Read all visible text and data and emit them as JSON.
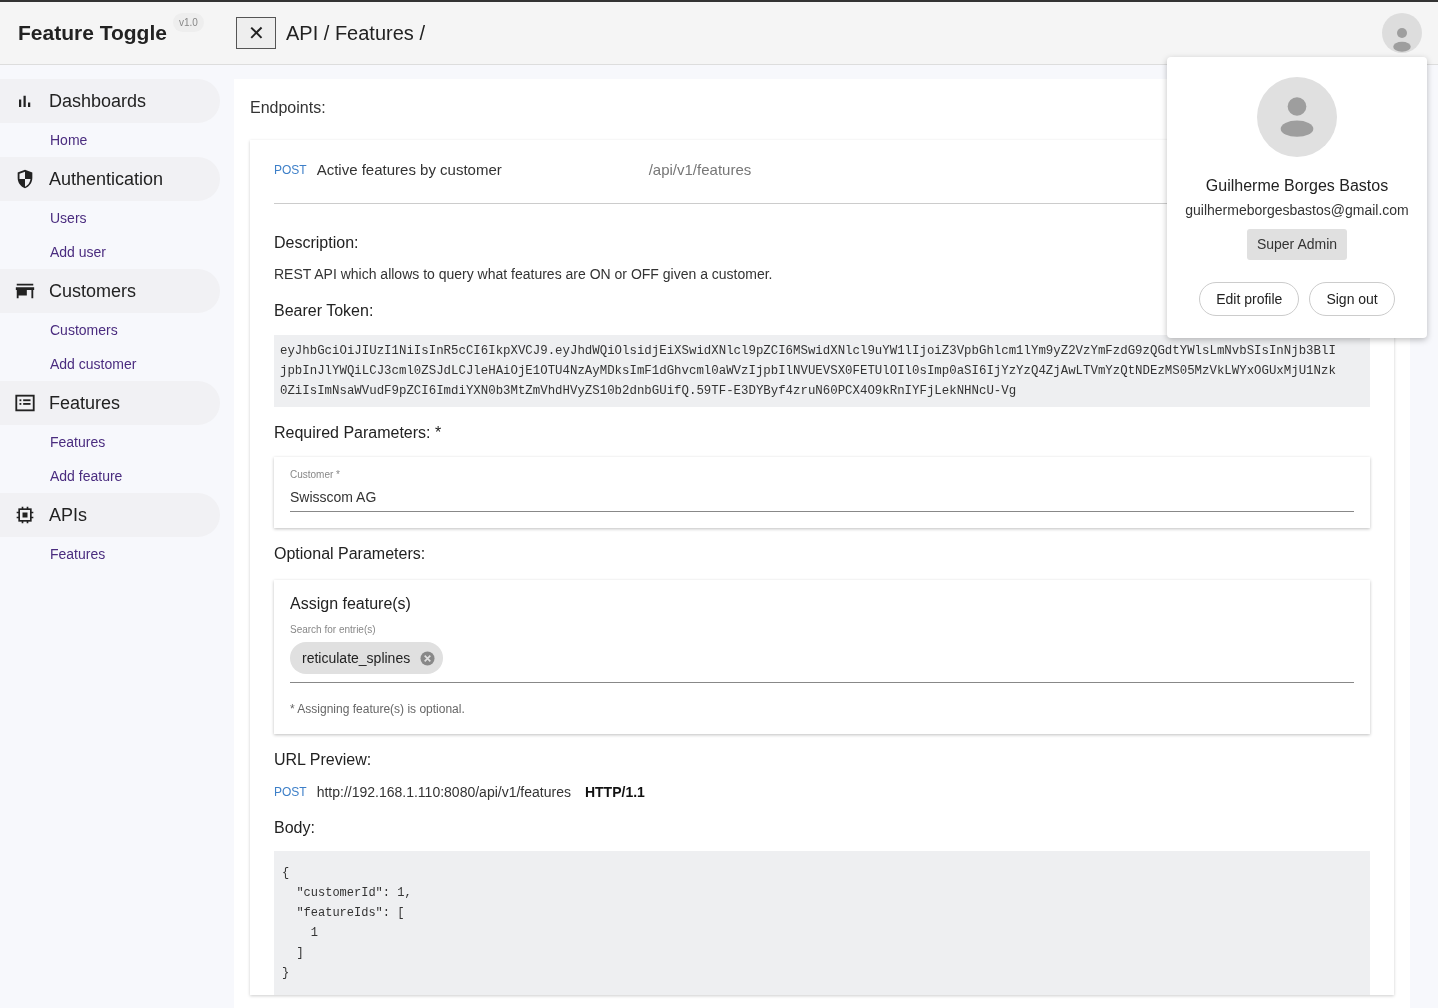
{
  "header": {
    "app_name": "Feature Toggle",
    "version": "v1.0",
    "close_symbol": "✕",
    "breadcrumb": "API / Features /"
  },
  "sidebar": {
    "groups": [
      {
        "label": "Dashboards",
        "items": [
          {
            "label": "Home"
          }
        ]
      },
      {
        "label": "Authentication",
        "items": [
          {
            "label": "Users"
          },
          {
            "label": "Add user"
          }
        ]
      },
      {
        "label": "Customers",
        "items": [
          {
            "label": "Customers"
          },
          {
            "label": "Add customer"
          }
        ]
      },
      {
        "label": "Features",
        "items": [
          {
            "label": "Features"
          },
          {
            "label": "Add feature"
          }
        ]
      },
      {
        "label": "APIs",
        "items": [
          {
            "label": "Features"
          }
        ]
      }
    ]
  },
  "main": {
    "title": "Endpoints:",
    "endpoint": {
      "method": "POST",
      "name": "Active features by customer",
      "path": "/api/v1/features"
    },
    "description_label": "Description:",
    "description": "REST API which allows to query what features are ON or OFF given a customer.",
    "token_label": "Bearer Token:",
    "token_lines": [
      "eyJhbGciOiJIUzI1NiIsInR5cCI6IkpXVCJ9.eyJhdWQiOlsidjEiXSwidXNlcl9pZCI6MSwidXNlcl9uYW1lIjoiZ3VpbGhlcm1lYm9yZ2VzYmFzdG9zQGdtYWlsLmNvbSIsInNjb3BlI",
      "jpbInJlYWQiLCJ3cml0ZSJdLCJleHAiOjE1OTU4NzAyMDksImF1dGhvcml0aWVzIjpbIlNVUEVSX0FETUlOIl0sImp0aSI6IjYzYzQ4ZjAwLTVmYzQtNDEzMS05MzVkLWYxOGUxMjU1Nzk",
      "0ZiIsImNsaWVudF9pZCI6ImdiYXN0b3MtZmVhdHVyZS10b2dnbGUifQ.59TF-E3DYByf4zruN60PCX4O9kRnIYFjLekNHNcU-Vg"
    ],
    "required_label": "Required Parameters: *",
    "customer_field": {
      "label": "Customer *",
      "value": "Swisscom AG"
    },
    "optional_label": "Optional Parameters:",
    "assign": {
      "title": "Assign feature(s)",
      "field_label": "Search for entrie(s)",
      "chips": [
        {
          "label": "reticulate_splines"
        }
      ],
      "hint": "* Assigning feature(s) is optional."
    },
    "url_label": "URL Preview:",
    "url": {
      "method": "POST",
      "address": "http://192.168.1.110:8080/api/v1/features",
      "protocol": "HTTP/1.1"
    },
    "body_label": "Body:",
    "body_lines": [
      "{",
      "  \"customerId\": 1,",
      "  \"featureIds\": [",
      "    1",
      "  ]",
      "}"
    ]
  },
  "profile_popup": {
    "name": "Guilherme Borges Bastos",
    "email": "guilhermeborgesbastos@gmail.com",
    "role": "Super Admin",
    "buttons": [
      "Edit profile",
      "Sign out"
    ]
  }
}
